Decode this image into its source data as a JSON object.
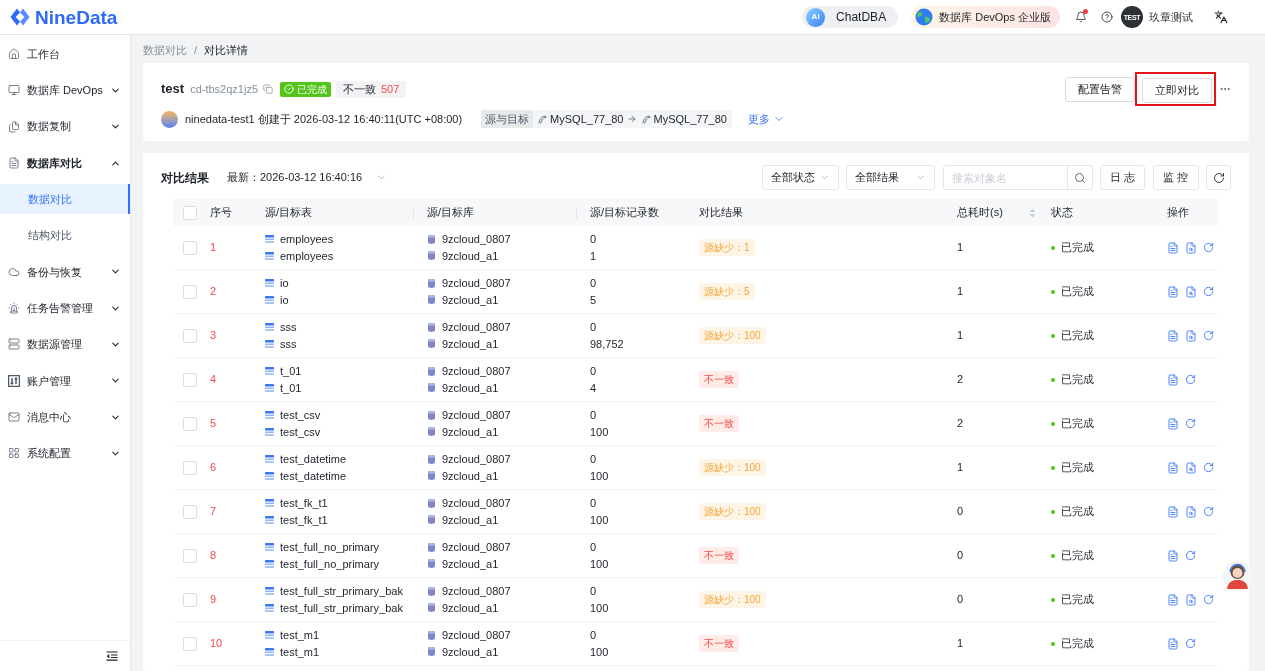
{
  "topbar": {
    "logo": "NineData",
    "chatdba": {
      "badge": "AI",
      "label": "ChatDBA"
    },
    "edition": "数据库 DevOps 企业版",
    "notifications": {
      "unread": true
    },
    "user": {
      "avatar_text": "TEST",
      "name": "玖章测试"
    }
  },
  "sidebar": {
    "items": [
      {
        "label": "工作台",
        "kind": "link",
        "selected": false
      },
      {
        "label": "数据库 DevOps",
        "kind": "group",
        "expanded": false
      },
      {
        "label": "数据复制",
        "kind": "group",
        "expanded": false
      },
      {
        "label": "数据库对比",
        "kind": "group",
        "expanded": true,
        "children": [
          {
            "label": "数据对比",
            "selected": true
          },
          {
            "label": "结构对比",
            "selected": false
          }
        ]
      },
      {
        "label": "备份与恢复",
        "kind": "group",
        "expanded": false
      },
      {
        "label": "任务告警管理",
        "kind": "group",
        "expanded": false
      },
      {
        "label": "数据源管理",
        "kind": "group",
        "expanded": false
      },
      {
        "label": "账户管理",
        "kind": "group",
        "expanded": false
      },
      {
        "label": "消息中心",
        "kind": "group",
        "expanded": false
      },
      {
        "label": "系统配置",
        "kind": "group",
        "expanded": false
      }
    ]
  },
  "breadcrumb": {
    "items": [
      "数据对比",
      "对比详情"
    ],
    "separator": "/"
  },
  "task": {
    "name": "test",
    "id": "cd-tbs2qz1jz5",
    "status": "已完成",
    "mismatch": {
      "label": "不一致",
      "count": "507"
    },
    "creator_line": "ninedata-test1 创建于 2026-03-12 16:40:11(UTC +08:00)",
    "endpoints": {
      "label": "源与目标",
      "source": "MySQL_77_80",
      "target": "MySQL_77_80"
    },
    "more": {
      "label": "更多",
      "expanded": false
    },
    "buttons": [
      {
        "label": "配置告警",
        "highlighted": false
      },
      {
        "label": "立即对比",
        "highlighted": true
      }
    ]
  },
  "results": {
    "title": "对比结果",
    "latest": "最新：2026-03-12 16:40:16",
    "filters": [
      "全部状态",
      "全部结果"
    ],
    "search": {
      "placeholder": "搜索对象名"
    },
    "buttons": [
      "日 志",
      "监 控"
    ],
    "table": {
      "all_checked": false,
      "columns": [
        {
          "label": "序号",
          "sortable": false
        },
        {
          "label": "源/目标表",
          "sortable": false
        },
        {
          "label": "源/目标库",
          "sortable": false
        },
        {
          "label": "源/目标记录数",
          "sortable": false
        },
        {
          "label": "对比结果",
          "sortable": false
        },
        {
          "label": "总耗时(s)",
          "sortable": true
        },
        {
          "label": "状态",
          "sortable": false
        },
        {
          "label": "操作",
          "sortable": false
        }
      ],
      "rows": [
        {
          "checked": false,
          "index": "1",
          "tables": [
            "employees",
            "employees"
          ],
          "databases": [
            "9zcloud_0807",
            "9zcloud_a1"
          ],
          "counts": [
            "0",
            "1"
          ],
          "result": {
            "kind": "missing",
            "label": "源缺少：1"
          },
          "duration": "1",
          "status": "已完成",
          "diff_action": true
        },
        {
          "checked": false,
          "index": "2",
          "tables": [
            "io",
            "io"
          ],
          "databases": [
            "9zcloud_0807",
            "9zcloud_a1"
          ],
          "counts": [
            "0",
            "5"
          ],
          "result": {
            "kind": "missing",
            "label": "源缺少：5"
          },
          "duration": "1",
          "status": "已完成",
          "diff_action": true
        },
        {
          "checked": false,
          "index": "3",
          "tables": [
            "sss",
            "sss"
          ],
          "databases": [
            "9zcloud_0807",
            "9zcloud_a1"
          ],
          "counts": [
            "0",
            "98,752"
          ],
          "result": {
            "kind": "missing",
            "label": "源缺少：100"
          },
          "duration": "1",
          "status": "已完成",
          "diff_action": true
        },
        {
          "checked": false,
          "index": "4",
          "tables": [
            "t_01",
            "t_01"
          ],
          "databases": [
            "9zcloud_0807",
            "9zcloud_a1"
          ],
          "counts": [
            "0",
            "4"
          ],
          "result": {
            "kind": "mismatch",
            "label": "不一致"
          },
          "duration": "2",
          "status": "已完成",
          "diff_action": false
        },
        {
          "checked": false,
          "index": "5",
          "tables": [
            "test_csv",
            "test_csv"
          ],
          "databases": [
            "9zcloud_0807",
            "9zcloud_a1"
          ],
          "counts": [
            "0",
            "100"
          ],
          "result": {
            "kind": "mismatch",
            "label": "不一致"
          },
          "duration": "2",
          "status": "已完成",
          "diff_action": false
        },
        {
          "checked": false,
          "index": "6",
          "tables": [
            "test_datetime",
            "test_datetime"
          ],
          "databases": [
            "9zcloud_0807",
            "9zcloud_a1"
          ],
          "counts": [
            "0",
            "100"
          ],
          "result": {
            "kind": "missing",
            "label": "源缺少：100"
          },
          "duration": "1",
          "status": "已完成",
          "diff_action": true
        },
        {
          "checked": false,
          "index": "7",
          "tables": [
            "test_fk_t1",
            "test_fk_t1"
          ],
          "databases": [
            "9zcloud_0807",
            "9zcloud_a1"
          ],
          "counts": [
            "0",
            "100"
          ],
          "result": {
            "kind": "missing",
            "label": "源缺少：100"
          },
          "duration": "0",
          "status": "已完成",
          "diff_action": true
        },
        {
          "checked": false,
          "index": "8",
          "tables": [
            "test_full_no_primary",
            "test_full_no_primary"
          ],
          "databases": [
            "9zcloud_0807",
            "9zcloud_a1"
          ],
          "counts": [
            "0",
            "100"
          ],
          "result": {
            "kind": "mismatch",
            "label": "不一致"
          },
          "duration": "0",
          "status": "已完成",
          "diff_action": false
        },
        {
          "checked": false,
          "index": "9",
          "tables": [
            "test_full_str_primary_bak",
            "test_full_str_primary_bak"
          ],
          "databases": [
            "9zcloud_0807",
            "9zcloud_a1"
          ],
          "counts": [
            "0",
            "100"
          ],
          "result": {
            "kind": "missing",
            "label": "源缺少：100"
          },
          "duration": "0",
          "status": "已完成",
          "diff_action": true
        },
        {
          "checked": false,
          "index": "10",
          "tables": [
            "test_m1",
            "test_m1"
          ],
          "databases": [
            "9zcloud_0807",
            "9zcloud_a1"
          ],
          "counts": [
            "0",
            "100"
          ],
          "result": {
            "kind": "mismatch",
            "label": "不一致"
          },
          "duration": "1",
          "status": "已完成",
          "diff_action": false
        }
      ]
    }
  }
}
